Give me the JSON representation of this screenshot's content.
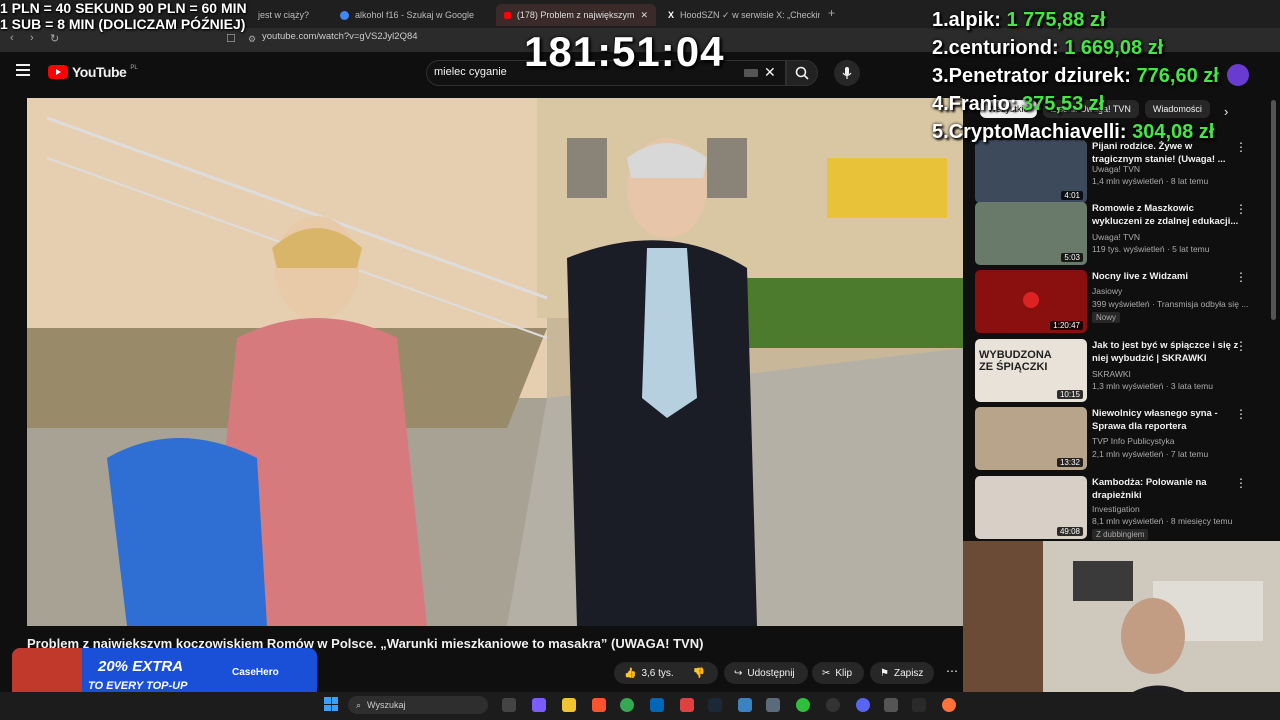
{
  "browser": {
    "tabs": [
      "jest w ciąży?",
      "alkohol f16 - Szukaj w Google",
      "(178) Problem z największym",
      "HoodSZN ✓ w serwisie X: „Checking"
    ],
    "url": "youtube.com/watch?v=gVS2Jyl2Q84"
  },
  "youtube": {
    "logo": "YouTube",
    "region": "PL",
    "search_value": "mielec cyganie",
    "chips": [
      "Wszystkie",
      "Z serii: Uwaga! TVN",
      "Wiadomości"
    ],
    "video_title": "Problem z największym koczowiskiem Romów w Polsce. „Warunki mieszkaniowe to masakra” (UWAGA! TVN)",
    "actions": {
      "likes": "3,6 tys.",
      "share": "Udostępnij",
      "clip": "Klip",
      "save": "Zapisz"
    },
    "recommendations": [
      {
        "title": "Pijani rodzice. Żywe w tragicznym stanie! (Uwaga! ...",
        "channel": "Uwaga! TVN",
        "meta": "1,4 mln wyświetleń · 8 lat temu",
        "duration": "4:01"
      },
      {
        "title": "Romowie z Maszkowic wykluczeni ze zdalnej edukacji...",
        "channel": "Uwaga! TVN",
        "meta": "119 tys. wyświetleń · 5 lat temu",
        "duration": "5:03"
      },
      {
        "title": "Nocny live z Widzami",
        "channel": "Jasiowy",
        "meta": "399 wyświetleń · Transmisja odbyła się ...",
        "duration": "1:20:47",
        "badge": "Nowy"
      },
      {
        "title": "Jak to jest być w śpiączce i się z niej wybudzić | SKRAWKI",
        "channel": "SKRAWKI",
        "meta": "1,3 mln wyświetleń · 3 lata temu",
        "duration": "10:15",
        "thumb_text": "WYBUDZONA ZE ŚPIĄCZKI"
      },
      {
        "title": "Niewolnicy własnego syna - Sprawa dla reportera",
        "channel": "TVP Info Publicystyka",
        "meta": "2,1 mln wyświetleń · 7 lat temu",
        "duration": "13:32"
      },
      {
        "title": "Kambodża: Polowanie na drapieżniki",
        "channel": "Investigation",
        "meta": "8,1 mln wyświetleń · 8 miesięcy temu",
        "duration": "49:08",
        "badge": "Z dubbingiem"
      }
    ]
  },
  "overlay": {
    "line1": "1 PLN = 40 SEKUND 90 PLN = 60 MIN",
    "line2": "1 SUB = 8 MIN (DOLICZAM PÓŹNIEJ)",
    "timer": "181:51:04",
    "leaderboard": [
      {
        "name": "1.alpik:",
        "amount": "1 775,88 zł"
      },
      {
        "name": "2.centuriond:",
        "amount": "1 669,08 zł"
      },
      {
        "name": "3.Penetrator dziurek:",
        "amount": "776,60 zł"
      },
      {
        "name": "4.Franio:",
        "amount": "375,53 zł"
      },
      {
        "name": "5.CryptoMachiavelli:",
        "amount": "304,08 zł"
      }
    ]
  },
  "ad": {
    "line1": "20% EXTRA",
    "line2": "TO EVERY TOP-UP",
    "brand": "CaseHero"
  },
  "taskbar": {
    "search_placeholder": "Wyszukaj"
  },
  "colors": {
    "accent_green": "#44e744",
    "youtube_red": "#ff0000",
    "ad_blue": "#1a4fd8"
  }
}
